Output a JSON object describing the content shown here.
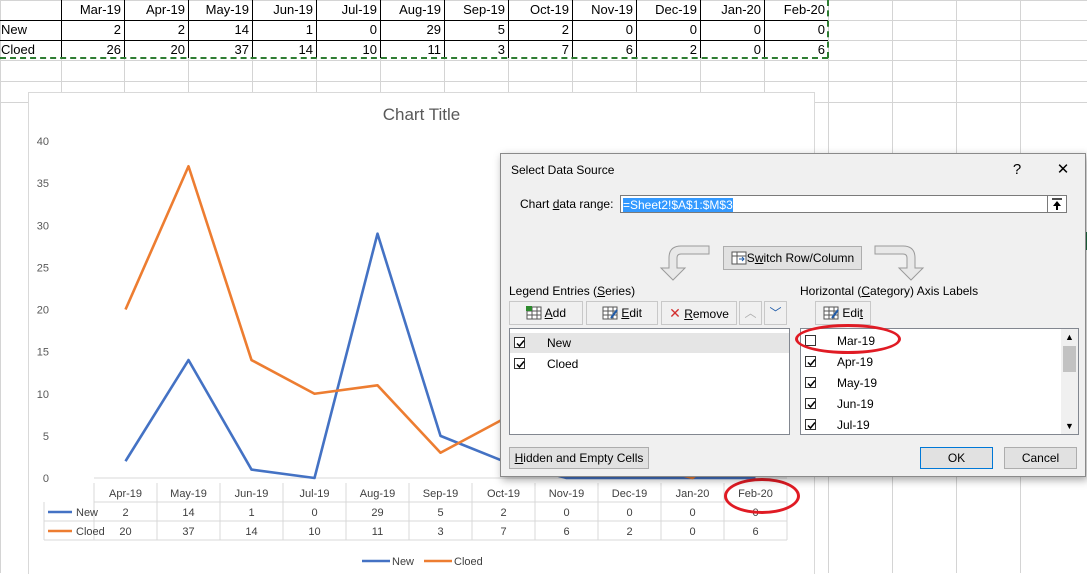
{
  "sheet": {
    "months": [
      "Mar-19",
      "Apr-19",
      "May-19",
      "Jun-19",
      "Jul-19",
      "Aug-19",
      "Sep-19",
      "Oct-19",
      "Nov-19",
      "Dec-19",
      "Jan-20",
      "Feb-20"
    ],
    "rows": [
      {
        "label": "New",
        "values": [
          2,
          2,
          14,
          1,
          0,
          29,
          5,
          2,
          0,
          0,
          0,
          0
        ]
      },
      {
        "label": "Cloed",
        "values": [
          26,
          20,
          37,
          14,
          10,
          11,
          3,
          7,
          6,
          2,
          0,
          6
        ]
      }
    ]
  },
  "chart": {
    "title": "Chart Title",
    "y_ticks": [
      "40",
      "35",
      "30",
      "25",
      "20",
      "15",
      "10",
      "5",
      "0"
    ],
    "table_header": [
      "Apr-19",
      "May-19",
      "Jun-19",
      "Jul-19",
      "Aug-19",
      "Sep-19",
      "Oct-19",
      "Nov-19",
      "Dec-19",
      "Jan-20",
      "Feb-20"
    ],
    "table_rows": [
      {
        "label": "New",
        "values": [
          "2",
          "14",
          "1",
          "0",
          "29",
          "5",
          "2",
          "0",
          "0",
          "0",
          "0"
        ]
      },
      {
        "label": "Cloed",
        "values": [
          "20",
          "37",
          "14",
          "10",
          "11",
          "3",
          "7",
          "6",
          "2",
          "0",
          "6"
        ]
      }
    ],
    "legend": [
      "New",
      "Cloed"
    ],
    "colors": {
      "New": "#4472c4",
      "Cloed": "#ed7d31"
    }
  },
  "chart_data": {
    "type": "line",
    "title": "Chart Title",
    "categories": [
      "Apr-19",
      "May-19",
      "Jun-19",
      "Jul-19",
      "Aug-19",
      "Sep-19",
      "Oct-19",
      "Nov-19",
      "Dec-19",
      "Jan-20",
      "Feb-20"
    ],
    "series": [
      {
        "name": "New",
        "values": [
          2,
          14,
          1,
          0,
          29,
          5,
          2,
          0,
          0,
          0,
          0
        ]
      },
      {
        "name": "Cloed",
        "values": [
          20,
          37,
          14,
          10,
          11,
          3,
          7,
          6,
          2,
          0,
          6
        ]
      }
    ],
    "ylim": [
      0,
      40
    ],
    "grid": false,
    "legend": "bottom",
    "data_table": true
  },
  "dialog": {
    "title": "Select Data Source",
    "help": "?",
    "close": "✕",
    "range_label_pre": "Chart ",
    "range_label_ul": "d",
    "range_label_post": "ata range:",
    "range_value": "=Sheet2!$A$1:$M$3",
    "switch_ul": "w",
    "switch_pre": "S",
    "switch_post": "itch Row/Column",
    "legend_title_pre": "Legend Entries (",
    "legend_title_ul": "S",
    "legend_title_post": "eries)",
    "add_ul": "A",
    "add_post": "dd",
    "edit_ul": "E",
    "edit_post": "dit",
    "remove_ul": "R",
    "remove_post": "emove",
    "series": [
      "New",
      "Cloed"
    ],
    "axis_title_pre": "Horizontal (",
    "axis_title_ul": "C",
    "axis_title_post": "ategory) Axis Labels",
    "axis_edit_pre": "Edi",
    "axis_edit_ul": "t",
    "axis_items": [
      {
        "label": "Mar-19",
        "checked": false
      },
      {
        "label": "Apr-19",
        "checked": true
      },
      {
        "label": "May-19",
        "checked": true
      },
      {
        "label": "Jun-19",
        "checked": true
      },
      {
        "label": "Jul-19",
        "checked": true
      }
    ],
    "hidden_ul": "H",
    "hidden_post": "idden and Empty Cells",
    "ok": "OK",
    "cancel": "Cancel"
  }
}
